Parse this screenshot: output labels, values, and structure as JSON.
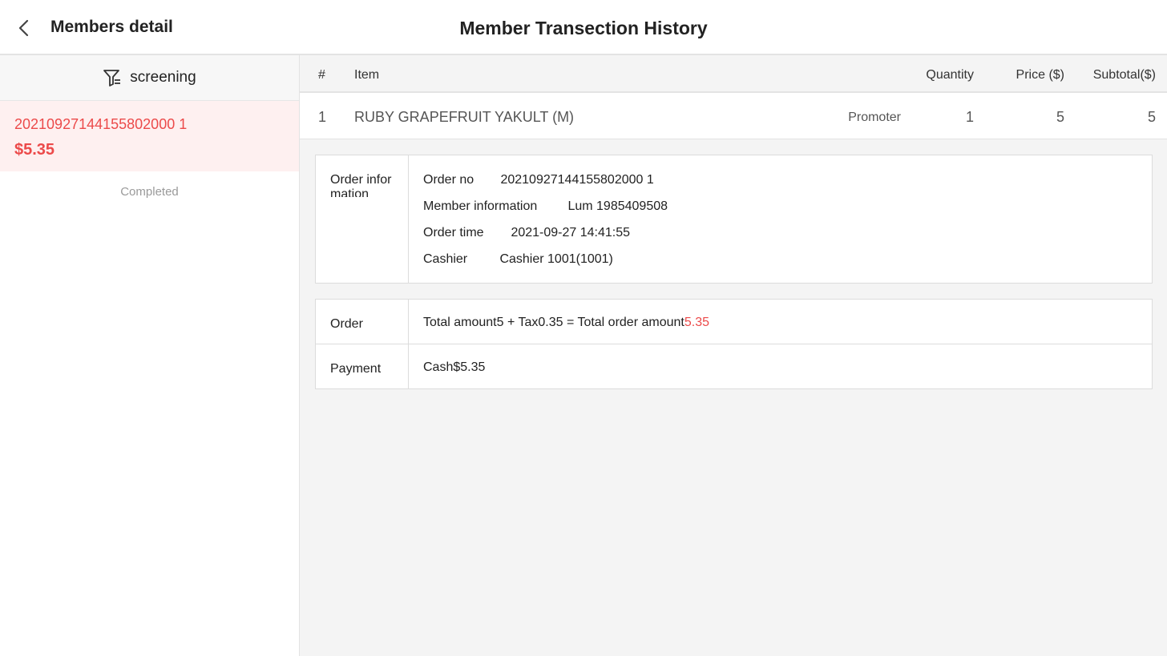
{
  "header": {
    "back_icon": "chevron-left-icon",
    "title": "Members detail",
    "page_title": "Member Transection History"
  },
  "sidebar": {
    "filter_icon": "filter-list-icon",
    "screening_label": "screening",
    "orders": [
      {
        "order_no": "20210927144155802000 1",
        "amount": "$5.35"
      }
    ],
    "status": "Completed"
  },
  "table": {
    "headers": {
      "num": "#",
      "item": "Item",
      "quantity": "Quantity",
      "price": "Price ($)",
      "subtotal": "Subtotal($)"
    },
    "rows": [
      {
        "num": "1",
        "item": "RUBY GRAPEFRUIT YAKULT (M)",
        "tag": "Promoter",
        "quantity": "1",
        "price": "5",
        "subtotal": "5"
      }
    ]
  },
  "order_information": {
    "section_label": "Order infor mation",
    "order_no_label": "Order no",
    "order_no_value": "20210927144155802000 1",
    "member_label": "Member information",
    "member_value": "Lum  1985409508",
    "time_label": "Order time",
    "time_value": "2021-09-27 14:41:55",
    "cashier_label": "Cashier",
    "cashier_value": "Cashier 1001(1001)"
  },
  "order_summary": {
    "order_label": "Order",
    "order_text": "Total amount5 + Tax0.35 = Total order amount",
    "order_total": "5.35",
    "payment_label": "Payment",
    "payment_value": "Cash$5.35"
  },
  "colors": {
    "accent": "#ec4a4a",
    "selected_bg": "#fef0f0",
    "panel_bg": "#f4f4f4"
  }
}
